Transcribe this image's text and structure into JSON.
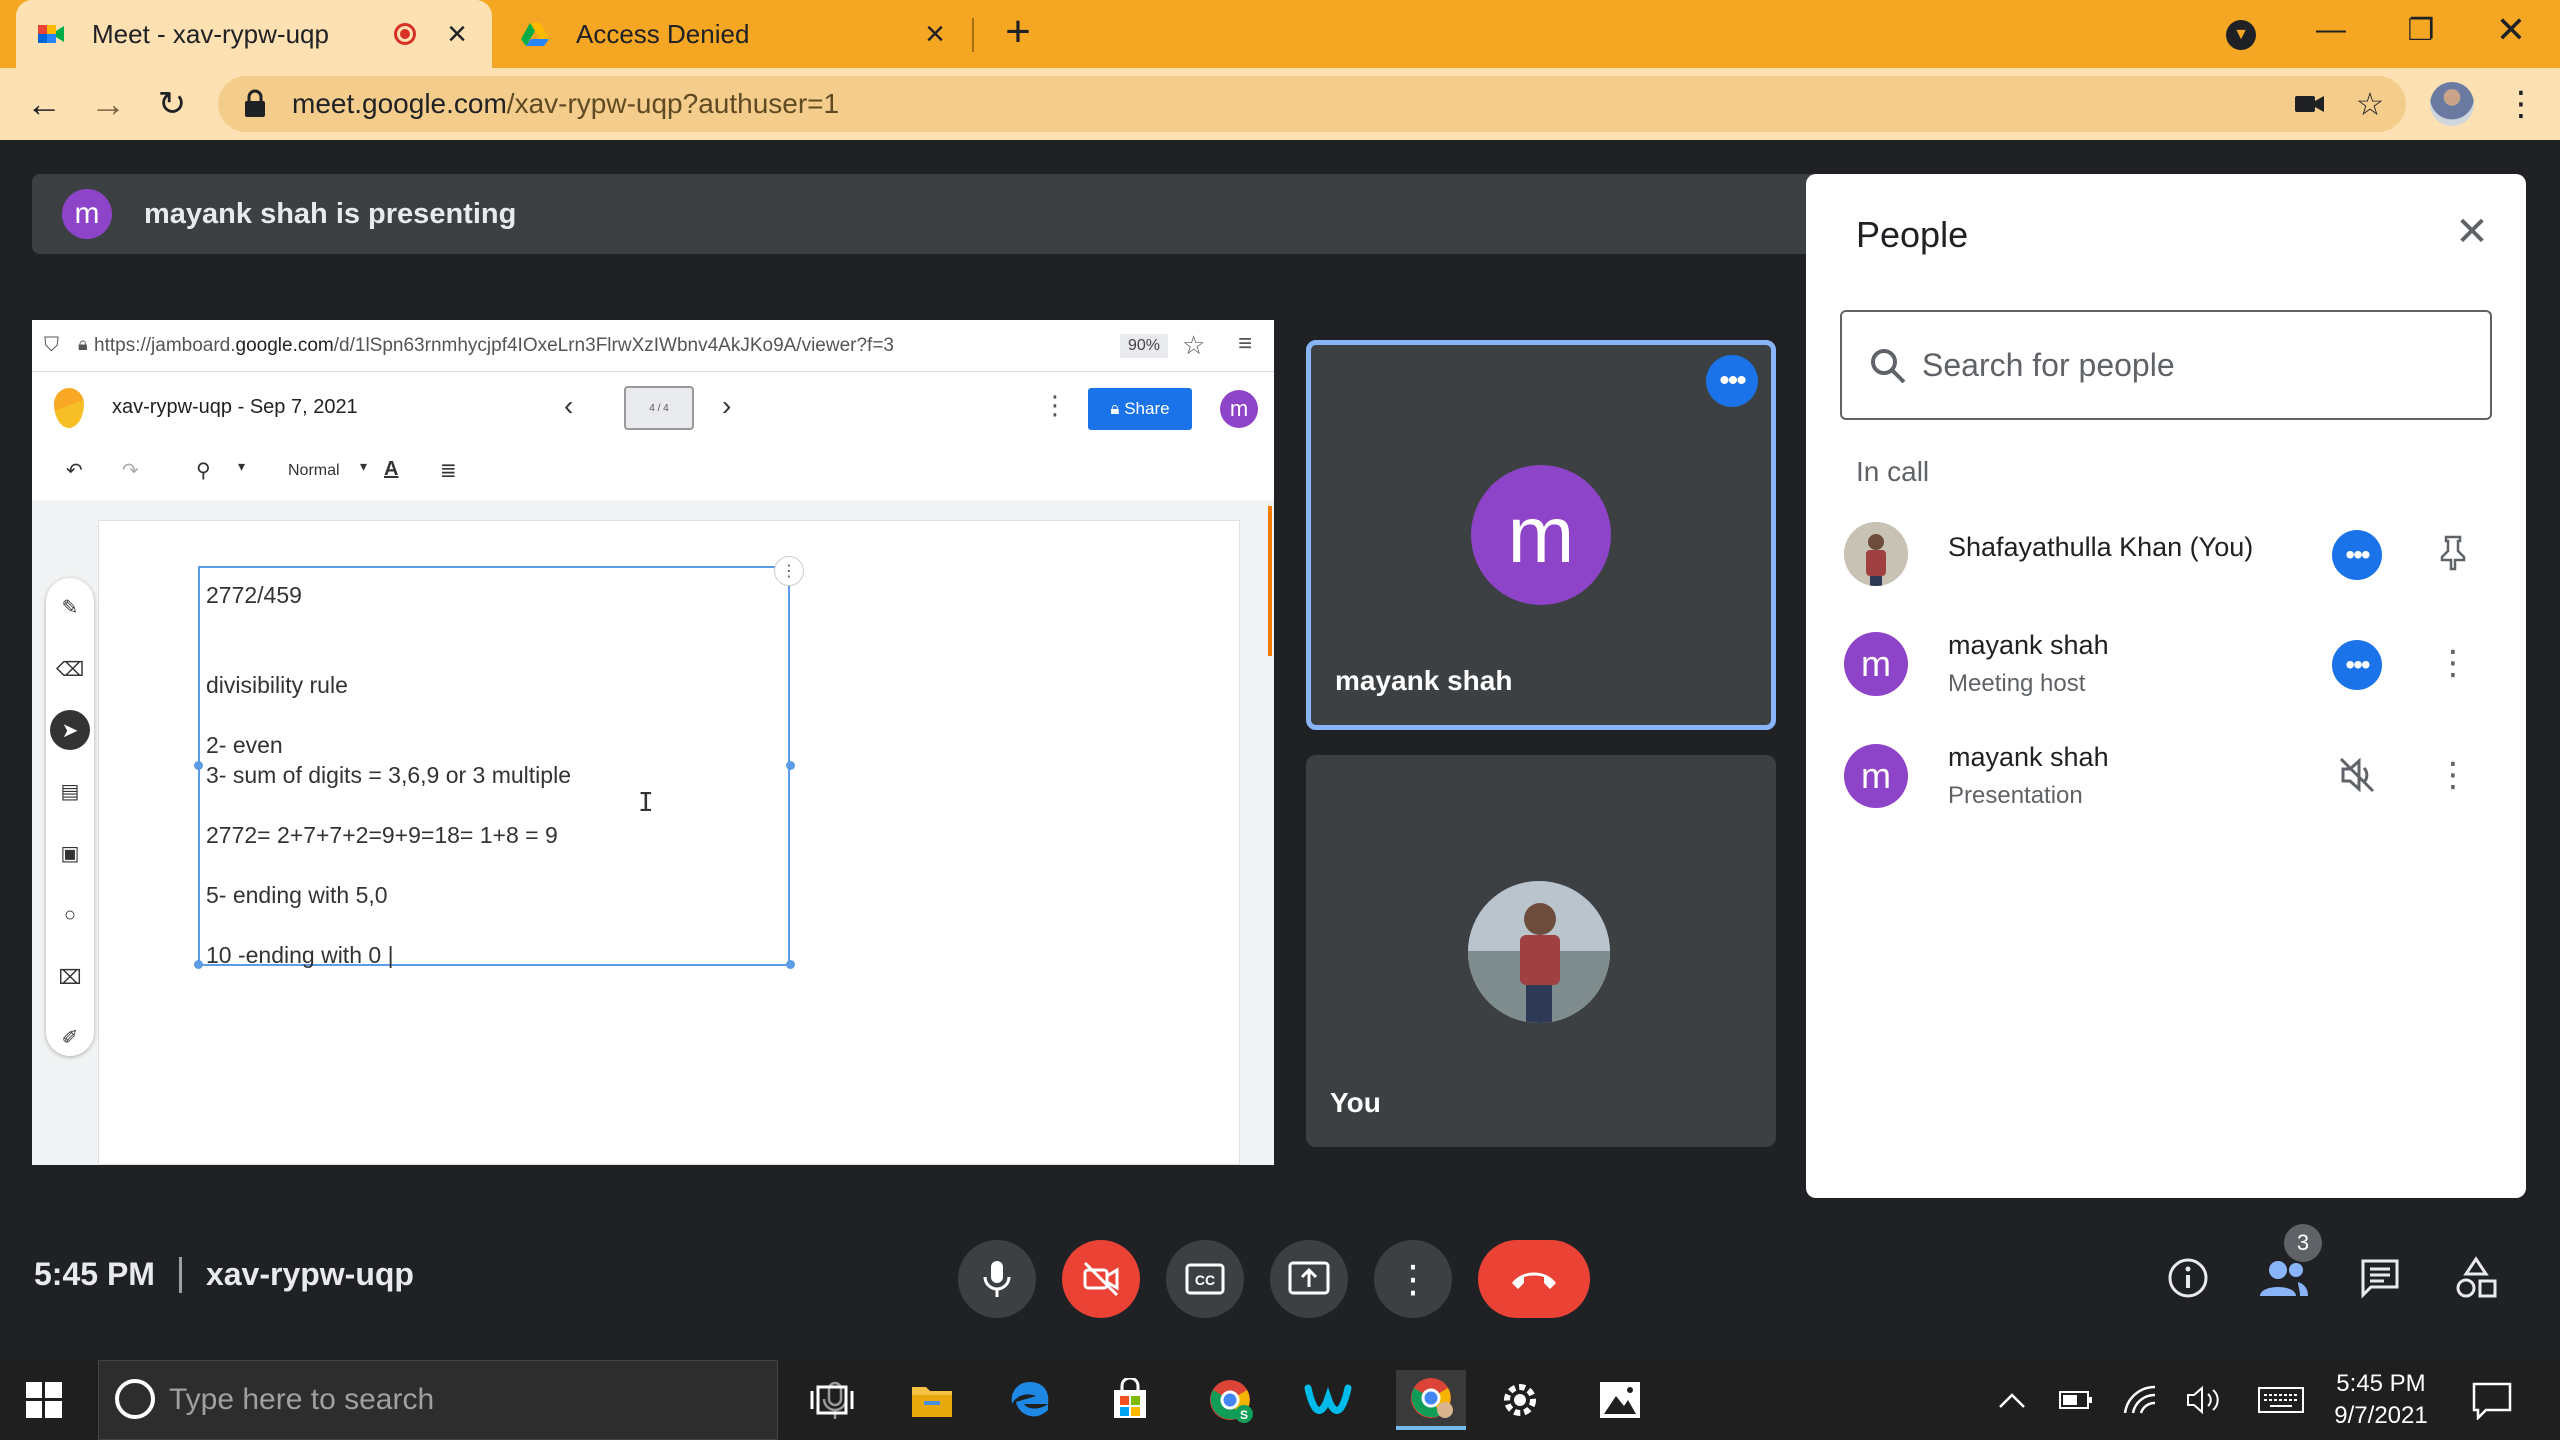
{
  "browser": {
    "tabs": [
      {
        "title": "Meet - xav-rypw-uqp",
        "active": true,
        "recording": true
      },
      {
        "title": "Access Denied",
        "active": false
      }
    ],
    "url_host": "meet.google.com",
    "url_path": "/xav-rypw-uqp?authuser=1"
  },
  "meet": {
    "presenting_initial": "m",
    "presenting_text": "mayank shah is presenting",
    "time": "5:45 PM",
    "meeting_code": "xav-rypw-uqp",
    "participant_count": "3"
  },
  "shared_screen": {
    "url_prefix": "https://jamboard.",
    "url_host": "google.com",
    "url_rest": "/d/1lSpn63rnmhycjpf4IOxeLrn3FlrwXzIWbnv4AkJKo9A/viewer?f=3",
    "zoom": "90%",
    "doc_title": "xav-rypw-uqp - Sep 7, 2021",
    "frame_indicator": "4 / 4",
    "share_label": "Share",
    "avatar_initial": "m",
    "text_style": "Normal",
    "note_lines": [
      "2772/459",
      "divisibility rule",
      "2- even",
      "3- sum of digits  = 3,6,9 or 3 multiple",
      "2772= 2+7+7+2=9+9=18= 1+8 = 9",
      "5- ending with 5,0",
      "10 -ending with  0 |"
    ]
  },
  "tiles": [
    {
      "name": "mayank shah",
      "initial": "m"
    },
    {
      "name": "You"
    }
  ],
  "people_panel": {
    "title": "People",
    "search_placeholder": "Search for people",
    "section_label": "In call",
    "people": [
      {
        "name": "Shafayathulla Khan (You)",
        "subtitle": ""
      },
      {
        "name": "mayank shah",
        "subtitle": "Meeting host",
        "initial": "m"
      },
      {
        "name": "mayank shah",
        "subtitle": "Presentation",
        "initial": "m"
      }
    ]
  },
  "taskbar": {
    "search_placeholder": "Type here to search",
    "time": "5:45 PM",
    "date": "9/7/2021"
  },
  "colors": {
    "chrome_frame": "#f5a623",
    "meet_bg": "#202124",
    "avatar_purple": "#8e44c8",
    "accent_blue": "#1a73e8",
    "end_call_red": "#ea4335"
  }
}
